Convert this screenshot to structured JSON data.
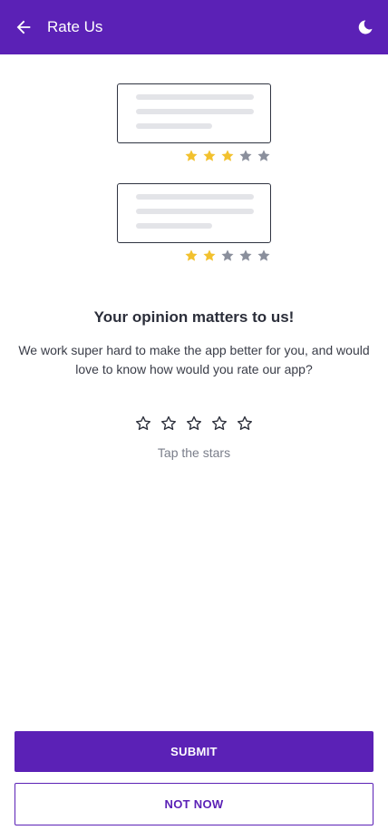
{
  "header": {
    "title": "Rate Us",
    "back_icon": "arrow-left-icon",
    "theme_icon": "moon-icon",
    "bg_color": "#5b21b6"
  },
  "illustration": {
    "cards": [
      {
        "rating": 3,
        "out_of": 5
      },
      {
        "rating": 2,
        "out_of": 5
      }
    ],
    "filled_star_color": "#f2c12e",
    "empty_star_color": "#8a8f9c"
  },
  "content": {
    "heading": "Your opinion matters to us!",
    "description": "We work super hard to make the app better for you, and would love to know how would you rate our app?"
  },
  "rating": {
    "value": 0,
    "max": 5,
    "hint": "Tap the stars"
  },
  "actions": {
    "submit_label": "SUBMIT",
    "not_now_label": "NOT NOW",
    "accent_color": "#5b21b6"
  }
}
